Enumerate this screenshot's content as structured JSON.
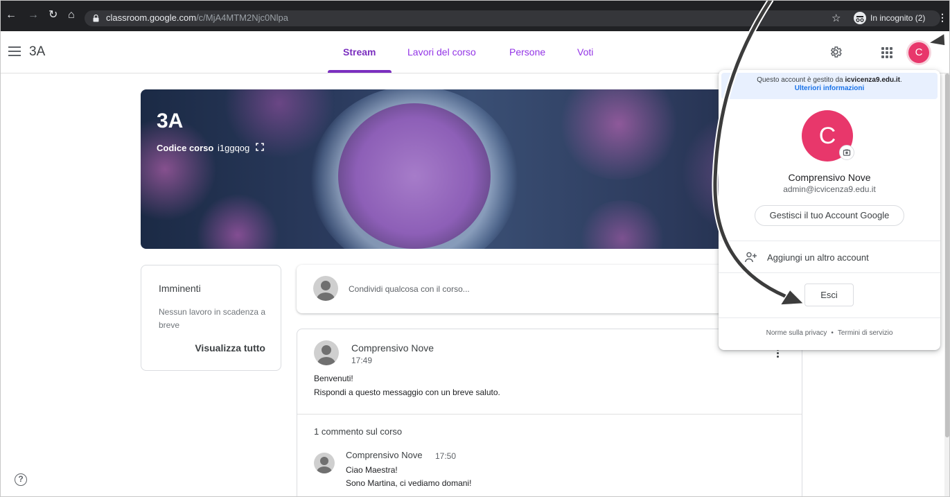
{
  "browser": {
    "url_host": "classroom.google.com",
    "url_path": "/c/MjA4MTM2Njc0Nlpa",
    "incognito_label": "In incognito (2)"
  },
  "header": {
    "class_title": "3A",
    "tabs": [
      {
        "label": "Stream",
        "active": true
      },
      {
        "label": "Lavori del corso"
      },
      {
        "label": "Persone"
      },
      {
        "label": "Voti"
      }
    ],
    "avatar_letter": "C"
  },
  "banner": {
    "title": "3A",
    "code_label": "Codice corso",
    "code_value": "i1ggqog"
  },
  "upcoming": {
    "title": "Imminenti",
    "text": "Nessun lavoro in scadenza a breve",
    "link": "Visualizza tutto"
  },
  "share": {
    "placeholder": "Condividi qualcosa con il corso..."
  },
  "post": {
    "author": "Comprensivo Nove",
    "time": "17:49",
    "line1": "Benvenuti!",
    "line2": "Rispondi a questo messaggio con un breve saluto.",
    "comment_count": "1 commento sul corso",
    "comment": {
      "author": "Comprensivo Nove",
      "time": "17:50",
      "line1": "Ciao Maestra!",
      "line2": "Sono Martina, ci vediamo domani!"
    }
  },
  "account": {
    "managed_prefix": "Questo account è gestito da",
    "managed_domain": "icvicenza9.edu.it",
    "managed_suffix": ".",
    "learn_more": "Ulteriori informazioni",
    "avatar_letter": "C",
    "name": "Comprensivo Nove",
    "email": "admin@icvicenza9.edu.it",
    "manage_label": "Gestisci il tuo Account Google",
    "add_account_label": "Aggiungi un altro account",
    "signout_label": "Esci",
    "privacy_label": "Norme sulla privacy",
    "separator": "•",
    "terms_label": "Termini di servizio"
  },
  "colors": {
    "accent": "#7b2fbf",
    "avatar": "#e8376b",
    "browser_bar": "#202124"
  }
}
